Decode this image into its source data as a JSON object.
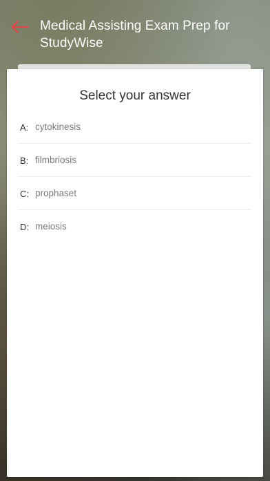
{
  "header": {
    "title_line1": "Medical Assisting Exam Prep for",
    "title_line2": "StudyWise",
    "back_icon": "arrow-left-icon",
    "accent_color": "#e0464a"
  },
  "question": {
    "prompt": "Select your answer",
    "options": [
      {
        "letter": "A:",
        "text": "cytokinesis"
      },
      {
        "letter": "B:",
        "text": "filmbriosis"
      },
      {
        "letter": "C:",
        "text": "prophaset"
      },
      {
        "letter": "D:",
        "text": "meiosis"
      }
    ]
  }
}
